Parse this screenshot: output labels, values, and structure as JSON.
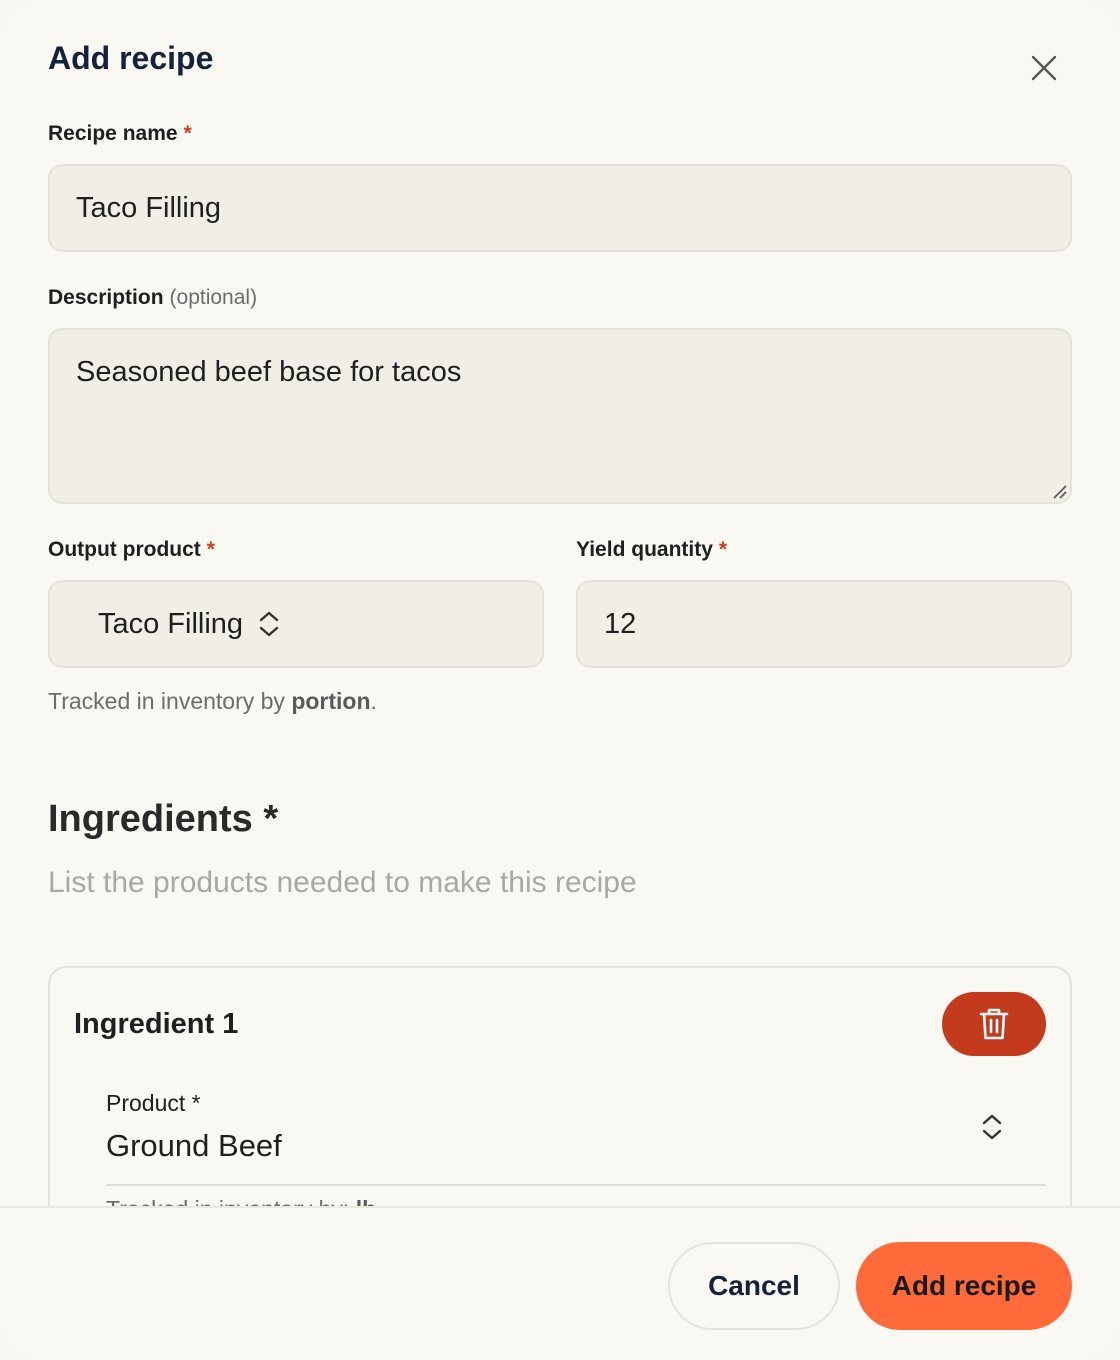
{
  "dialog": {
    "title": "Add recipe"
  },
  "form": {
    "recipe_name": {
      "label": "Recipe name",
      "required_mark": "*",
      "value": "Taco Filling"
    },
    "description": {
      "label": "Description",
      "optional_note": "(optional)",
      "value": "Seasoned beef base for tacos"
    },
    "output_product": {
      "label": "Output product",
      "required_mark": "*",
      "value": "Taco Filling"
    },
    "yield_quantity": {
      "label": "Yield quantity",
      "required_mark": "*",
      "value": "12"
    },
    "tracking_help": {
      "prefix": "Tracked in inventory by ",
      "unit": "portion",
      "suffix": "."
    }
  },
  "ingredients": {
    "title": "Ingredients *",
    "subtitle": "List the products needed to make this recipe",
    "items": [
      {
        "title": "Ingredient 1",
        "product_label": "Product *",
        "product_value": "Ground Beef",
        "help_prefix": "Tracked in inventory by: ",
        "help_unit": "lb"
      }
    ]
  },
  "footer": {
    "cancel_label": "Cancel",
    "submit_label": "Add recipe"
  },
  "colors": {
    "accent": "#ff6a3a",
    "danger": "#c43a1c",
    "required": "#c8401e",
    "field_bg": "#f1eee5"
  },
  "icons": {
    "close": "close-icon",
    "select_chevrons": "chevron-up-down-icon",
    "delete": "trash-icon"
  }
}
